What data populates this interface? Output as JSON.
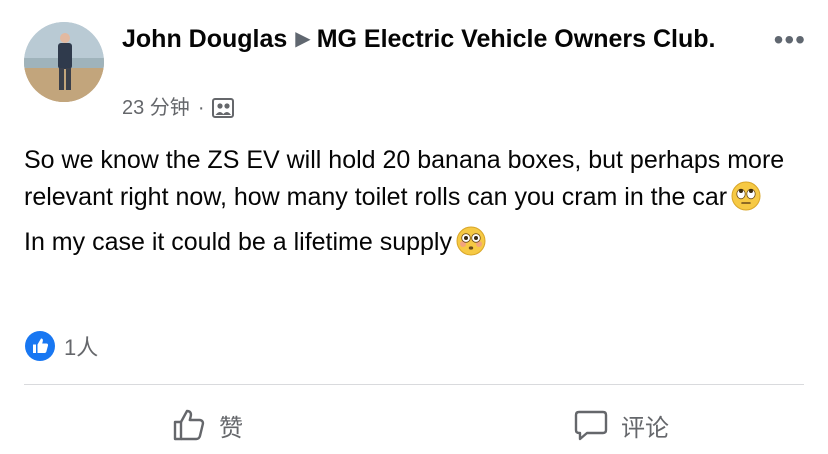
{
  "post": {
    "author": "John Douglas",
    "group": "MG Electric Vehicle Owners Club.",
    "time": "23 分钟",
    "separator": "·",
    "more_label": "•••",
    "text_line1": "So we know the ZS EV will hold 20 banana boxes, but perhaps more relevant right now, how many toilet rolls can you cram in the car",
    "text_line2": "In my case it could be a lifetime supply",
    "emoji_1": "face-with-rolling-eyes",
    "emoji_2": "flushed-face"
  },
  "reactions": {
    "count": "1人",
    "icon": "like-icon",
    "accent": "#1877f2"
  },
  "actions": {
    "like_label": "赞",
    "comment_label": "评论"
  }
}
